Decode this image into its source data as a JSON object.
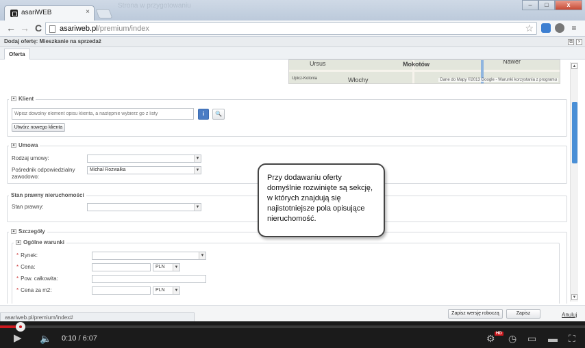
{
  "browser": {
    "tab_title": "asariWEB",
    "tab_close": "×",
    "ghost_title": "Strona w przygotowaniu",
    "win_buttons": [
      "–",
      "□",
      "x"
    ],
    "url_domain": "asariweb.pl",
    "url_path": "/premium/index"
  },
  "app": {
    "header_title": "Dodaj ofertę: Mieszkanie na sprzedaż",
    "header_buttons": [
      "⧉",
      "×"
    ],
    "tab": "Oferta"
  },
  "map": {
    "labels": [
      "Ursus",
      "Mokotów",
      "Nawer",
      "Upicz-Kolonia",
      "Włochy"
    ],
    "copyright": "Dane do Mapy ©2013 Google - Warunki korzystania z programu"
  },
  "klient": {
    "legend": "Klient",
    "search_placeholder": "Wpisz dowolny element opisu klienta, a następnie wybierz go z listy",
    "new_client_button": "Utwórz nowego klienta"
  },
  "umowa": {
    "legend": "Umowa",
    "rodzaj_label": "Rodzaj umowy:",
    "rodzaj_value": "",
    "posrednik_label": "Pośrednik odpowiedzialny zawodowo:",
    "posrednik_value": "Michał Rozwałka"
  },
  "stan": {
    "legend": "Stan prawny nieruchomości",
    "label": "Stan prawny:",
    "value": ""
  },
  "szczegoly": {
    "legend": "Szczegóły",
    "sub_legend": "Ogólne warunki",
    "rynek_label": "Rynek:",
    "cena_label": "Cena:",
    "cena_currency": "PLN",
    "pow_label": "Pow. całkowita:",
    "cena_m2_label": "Cena za m2:",
    "cena_m2_currency": "PLN",
    "required_mark": "*"
  },
  "callout": {
    "text": "Przy dodawaniu oferty domyślnie rozwinięte są sekcję, w których znajdują się najistotniejsze pola opisujące nieruchomość."
  },
  "footer": {
    "draft_button": "Zapisz wersję roboczą",
    "save_button": "Zapisz",
    "cancel_link": "Anuluj",
    "status_url": "asariweb.pl/premium/index#"
  },
  "player": {
    "current_time": "0:10",
    "separator": " / ",
    "duration": "6:07",
    "hd": "HD",
    "progress": 0.027,
    "accent": "#cc181e"
  },
  "icons": {
    "back": "←",
    "forward": "→",
    "reload": "C",
    "star": "☆",
    "info": "i",
    "search": "🔍",
    "up": "▲",
    "down": "▼",
    "play": "▶",
    "volume": "🔈",
    "settings": "⚙",
    "clock": "◷",
    "small_player": "▭",
    "theater": "▬",
    "fullscreen": "⛶"
  }
}
